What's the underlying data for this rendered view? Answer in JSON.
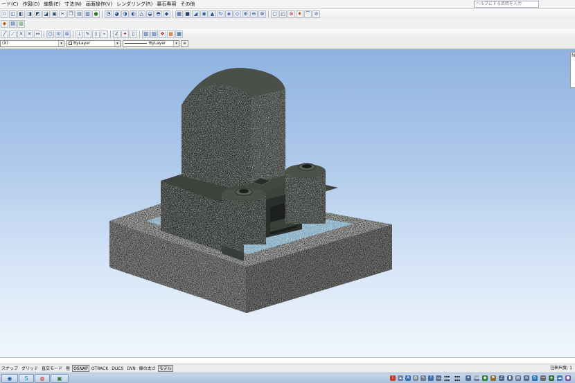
{
  "menu": {
    "items": [
      "ード(C)",
      "作図(D)",
      "編集(E)",
      "寸法(N)",
      "画面操作(V)",
      "レンダリング(R)",
      "墓石専用",
      "その他"
    ],
    "help_search_placeholder": "ヘルプにする質問を入力"
  },
  "properties": {
    "layer_value": "(X)",
    "color_value": "ByLayer",
    "linetype_value": "ByLayer"
  },
  "status_bar": {
    "toggles": [
      {
        "label": "スナップ",
        "on": false
      },
      {
        "label": "グリッド",
        "on": false
      },
      {
        "label": "直交モード",
        "on": false
      },
      {
        "label": "極",
        "on": false
      },
      {
        "label": "OSNAP",
        "on": true
      },
      {
        "label": "OTRACK",
        "on": false
      },
      {
        "label": "DUCS",
        "on": false
      },
      {
        "label": "DYN",
        "on": false
      },
      {
        "label": "線の太さ",
        "on": false
      },
      {
        "label": "モデル",
        "on": true
      }
    ],
    "right_label": "注釈尺度: 1"
  },
  "icons": {
    "side_palette": [
      "palette-icon"
    ],
    "taskbar": [
      "start-icon",
      "skype-icon",
      "chrome-icon",
      "cad-app-icon"
    ]
  },
  "colors": {
    "viewport_sky_top": "#8fb3e0",
    "granite_dark": "#2c2f2b",
    "granite_light": "#a7a9a6",
    "blue_gravel": "#7fa8bf"
  }
}
